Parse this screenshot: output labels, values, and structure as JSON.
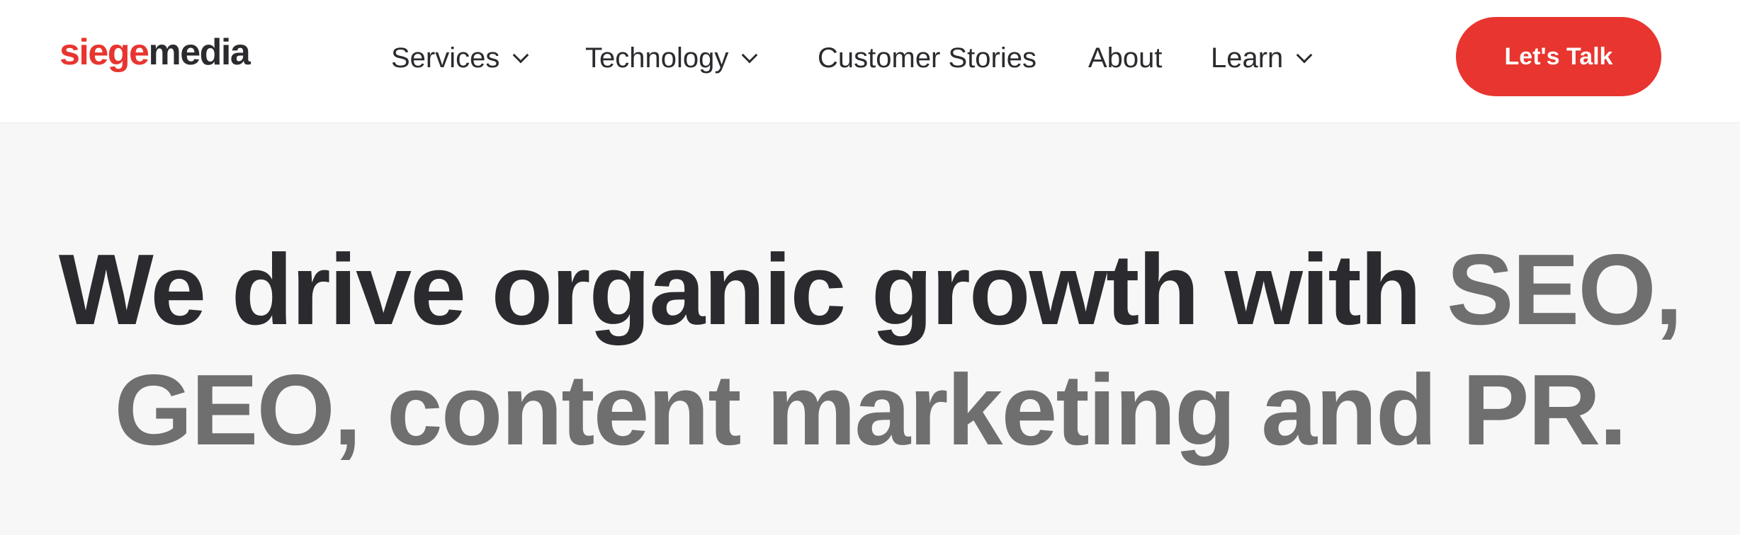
{
  "header": {
    "logo": {
      "part1": "siege",
      "part2": "media",
      "colors": {
        "part1": "#e8352f",
        "part2": "#2b2b2f"
      }
    },
    "nav": [
      {
        "label": "Services",
        "has_dropdown": true,
        "icon": "chevron-down-icon"
      },
      {
        "label": "Technology",
        "has_dropdown": true,
        "icon": "chevron-down-icon"
      },
      {
        "label": "Customer Stories",
        "has_dropdown": false
      },
      {
        "label": "About",
        "has_dropdown": false
      },
      {
        "label": "Learn",
        "has_dropdown": true,
        "icon": "chevron-down-icon"
      }
    ],
    "cta": {
      "label": "Let's Talk",
      "color": "#e8352f"
    }
  },
  "hero": {
    "headline_dark": "We drive organic growth with",
    "headline_gray_line1": "SEO,",
    "headline_gray_line2": "GEO, content marketing and PR.",
    "colors": {
      "dark": "#2b2b2f",
      "gray": "#6f6f6f"
    }
  }
}
